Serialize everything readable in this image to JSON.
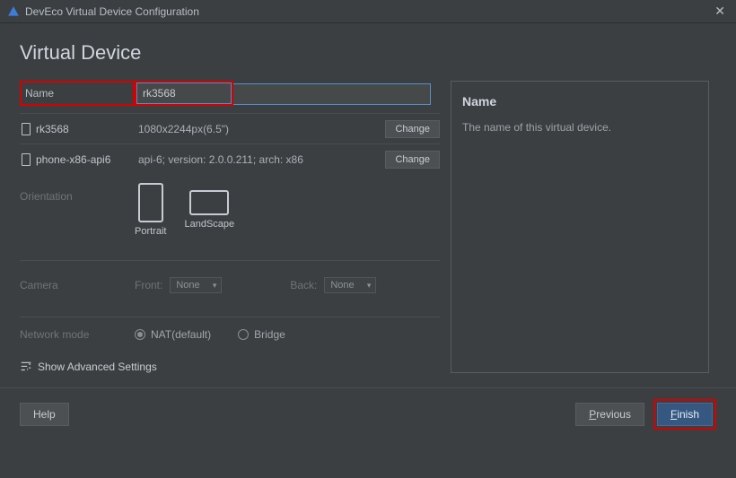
{
  "titlebar": {
    "title": "DevEco Virtual Device Configuration"
  },
  "heading": "Virtual Device",
  "name": {
    "label": "Name",
    "value": "rk3568"
  },
  "devices": [
    {
      "name": "rk3568",
      "spec": "1080x2244px(6.5\")",
      "change_label": "Change"
    },
    {
      "name": "phone-x86-api6",
      "spec": "api-6; version: 2.0.0.211; arch: x86",
      "change_label": "Change"
    }
  ],
  "orientation": {
    "label": "Orientation",
    "options": {
      "portrait": "Portrait",
      "landscape": "LandScape"
    }
  },
  "camera": {
    "label": "Camera",
    "front": {
      "label": "Front:",
      "value": "None"
    },
    "back": {
      "label": "Back:",
      "value": "None"
    }
  },
  "network": {
    "label": "Network mode",
    "options": {
      "nat": "NAT(default)",
      "bridge": "Bridge"
    },
    "selected": "nat"
  },
  "advanced_label": "Show Advanced Settings",
  "info": {
    "title": "Name",
    "desc": "The name of this virtual device."
  },
  "footer": {
    "help": "Help",
    "previous": "Previous",
    "finish": "Finish"
  }
}
